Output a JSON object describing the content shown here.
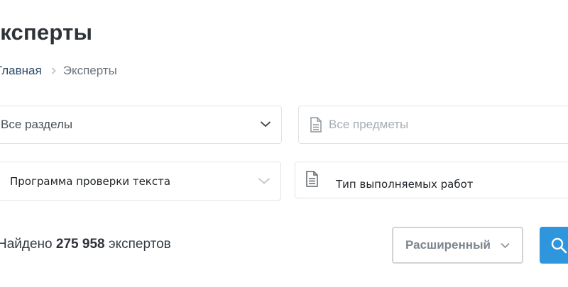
{
  "page": {
    "title": "Эксперты"
  },
  "breadcrumb": {
    "home": "Главная",
    "current": "Эксперты"
  },
  "filters": {
    "sections": {
      "value": "Все разделы",
      "icon": "chevron-down-icon"
    },
    "subjects": {
      "placeholder": "Все предметы",
      "icon": "document-icon"
    },
    "checker": {
      "value": "Программа проверки текста",
      "icon": "chevron-down-icon"
    },
    "work_type": {
      "value": "Тип выполняемых работ",
      "icon": "document-icon"
    }
  },
  "results": {
    "prefix": "Найдено",
    "count": "275 958",
    "suffix": "экспертов"
  },
  "actions": {
    "advanced_label": "Расширенный",
    "search_icon": "search-icon"
  },
  "colors": {
    "accent": "#2f95dc",
    "link": "#2b4a66",
    "border": "#dfe3e7"
  }
}
